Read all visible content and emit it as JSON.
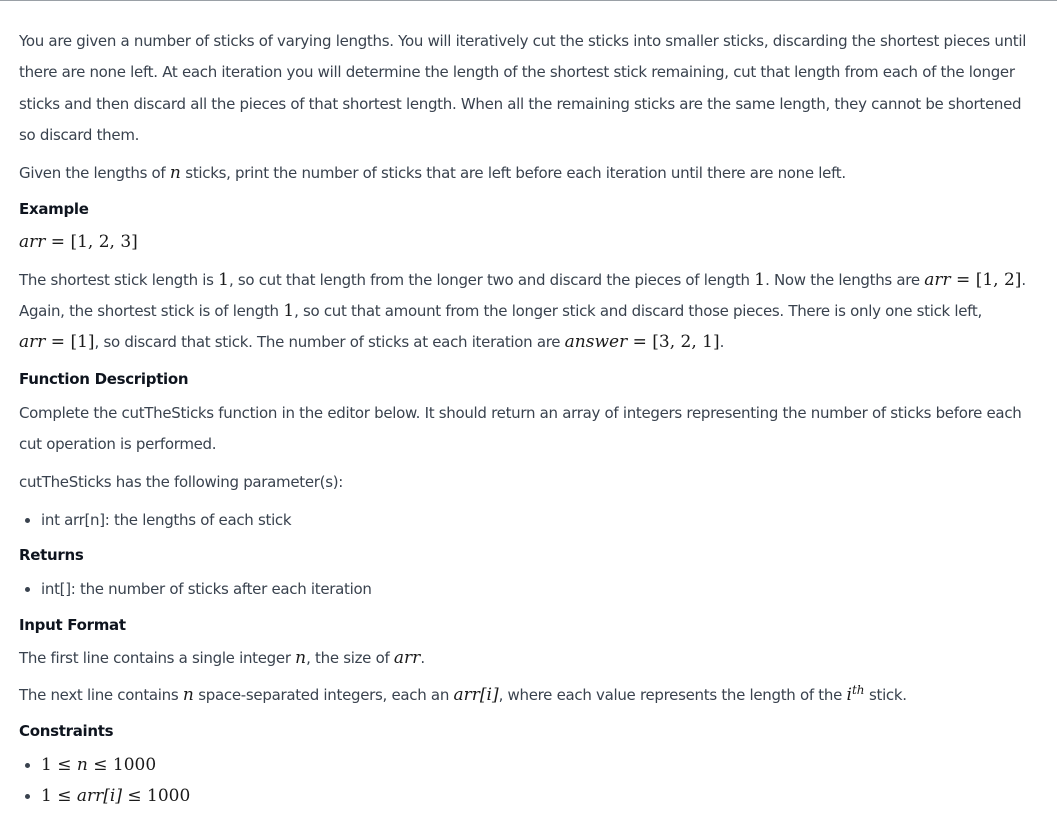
{
  "intro": {
    "p1": "You are given a number of sticks of varying lengths. You will iteratively cut the sticks into smaller sticks, discarding the shortest pieces until there are none left. At each iteration you will determine the length of the shortest stick remaining, cut that length from each of the longer sticks and then discard all the pieces of that shortest length. When all the remaining sticks are the same length, they cannot be shortened so discard them.",
    "p2a": "Given the lengths of ",
    "p2n": "n",
    "p2b": " sticks, print the number of sticks that are left before each iteration until there are none left."
  },
  "example": {
    "heading": "Example",
    "arr_var": "arr",
    "arr_value": " = [1, 2, 3]",
    "s1": "The shortest stick length is ",
    "one": "1",
    "s2": ", so cut that length from the longer two and discard the pieces of length ",
    "s3": ". Now the lengths are ",
    "arr2": " = [1, 2]",
    "s4": ".",
    "s5": "Again, the shortest stick is of length ",
    "s6": ", so cut that amount from the longer stick and discard those pieces. There is only one stick left,",
    "arr3": " = [1]",
    "s7": ", so discard that stick. The number of sticks at each iteration are ",
    "answer_var": "answer",
    "answer_value": " = [3, 2, 1]",
    "s8": "."
  },
  "function_description": {
    "heading": "Function Description",
    "p1": "Complete the cutTheSticks function in the editor below. It should return an array of integers representing the number of sticks before each cut operation is performed.",
    "p2": "cutTheSticks has the following parameter(s):",
    "params": [
      "int arr[n]: the lengths of each stick"
    ]
  },
  "returns": {
    "heading": "Returns",
    "items": [
      "int[]: the number of sticks after each iteration"
    ]
  },
  "input_format": {
    "heading": "Input Format",
    "l1a": "The first line contains a single integer ",
    "n": "n",
    "l1b": ", the size of ",
    "arr": "arr",
    "l1c": ".",
    "l2a": "The next line contains ",
    "l2b": " space-separated integers, each an ",
    "arr_i": "arr[i]",
    "l2c": ", where each value represents the length of the ",
    "i": "i",
    "th": "th",
    "l2d": " stick."
  },
  "constraints": {
    "heading": "Constraints",
    "c1_lhs": "1 ≤ ",
    "c1_var": "n",
    "c1_rhs": " ≤ 1000",
    "c2_lhs": "1 ≤ ",
    "c2_var": "arr[i]",
    "c2_rhs": " ≤ 1000"
  }
}
